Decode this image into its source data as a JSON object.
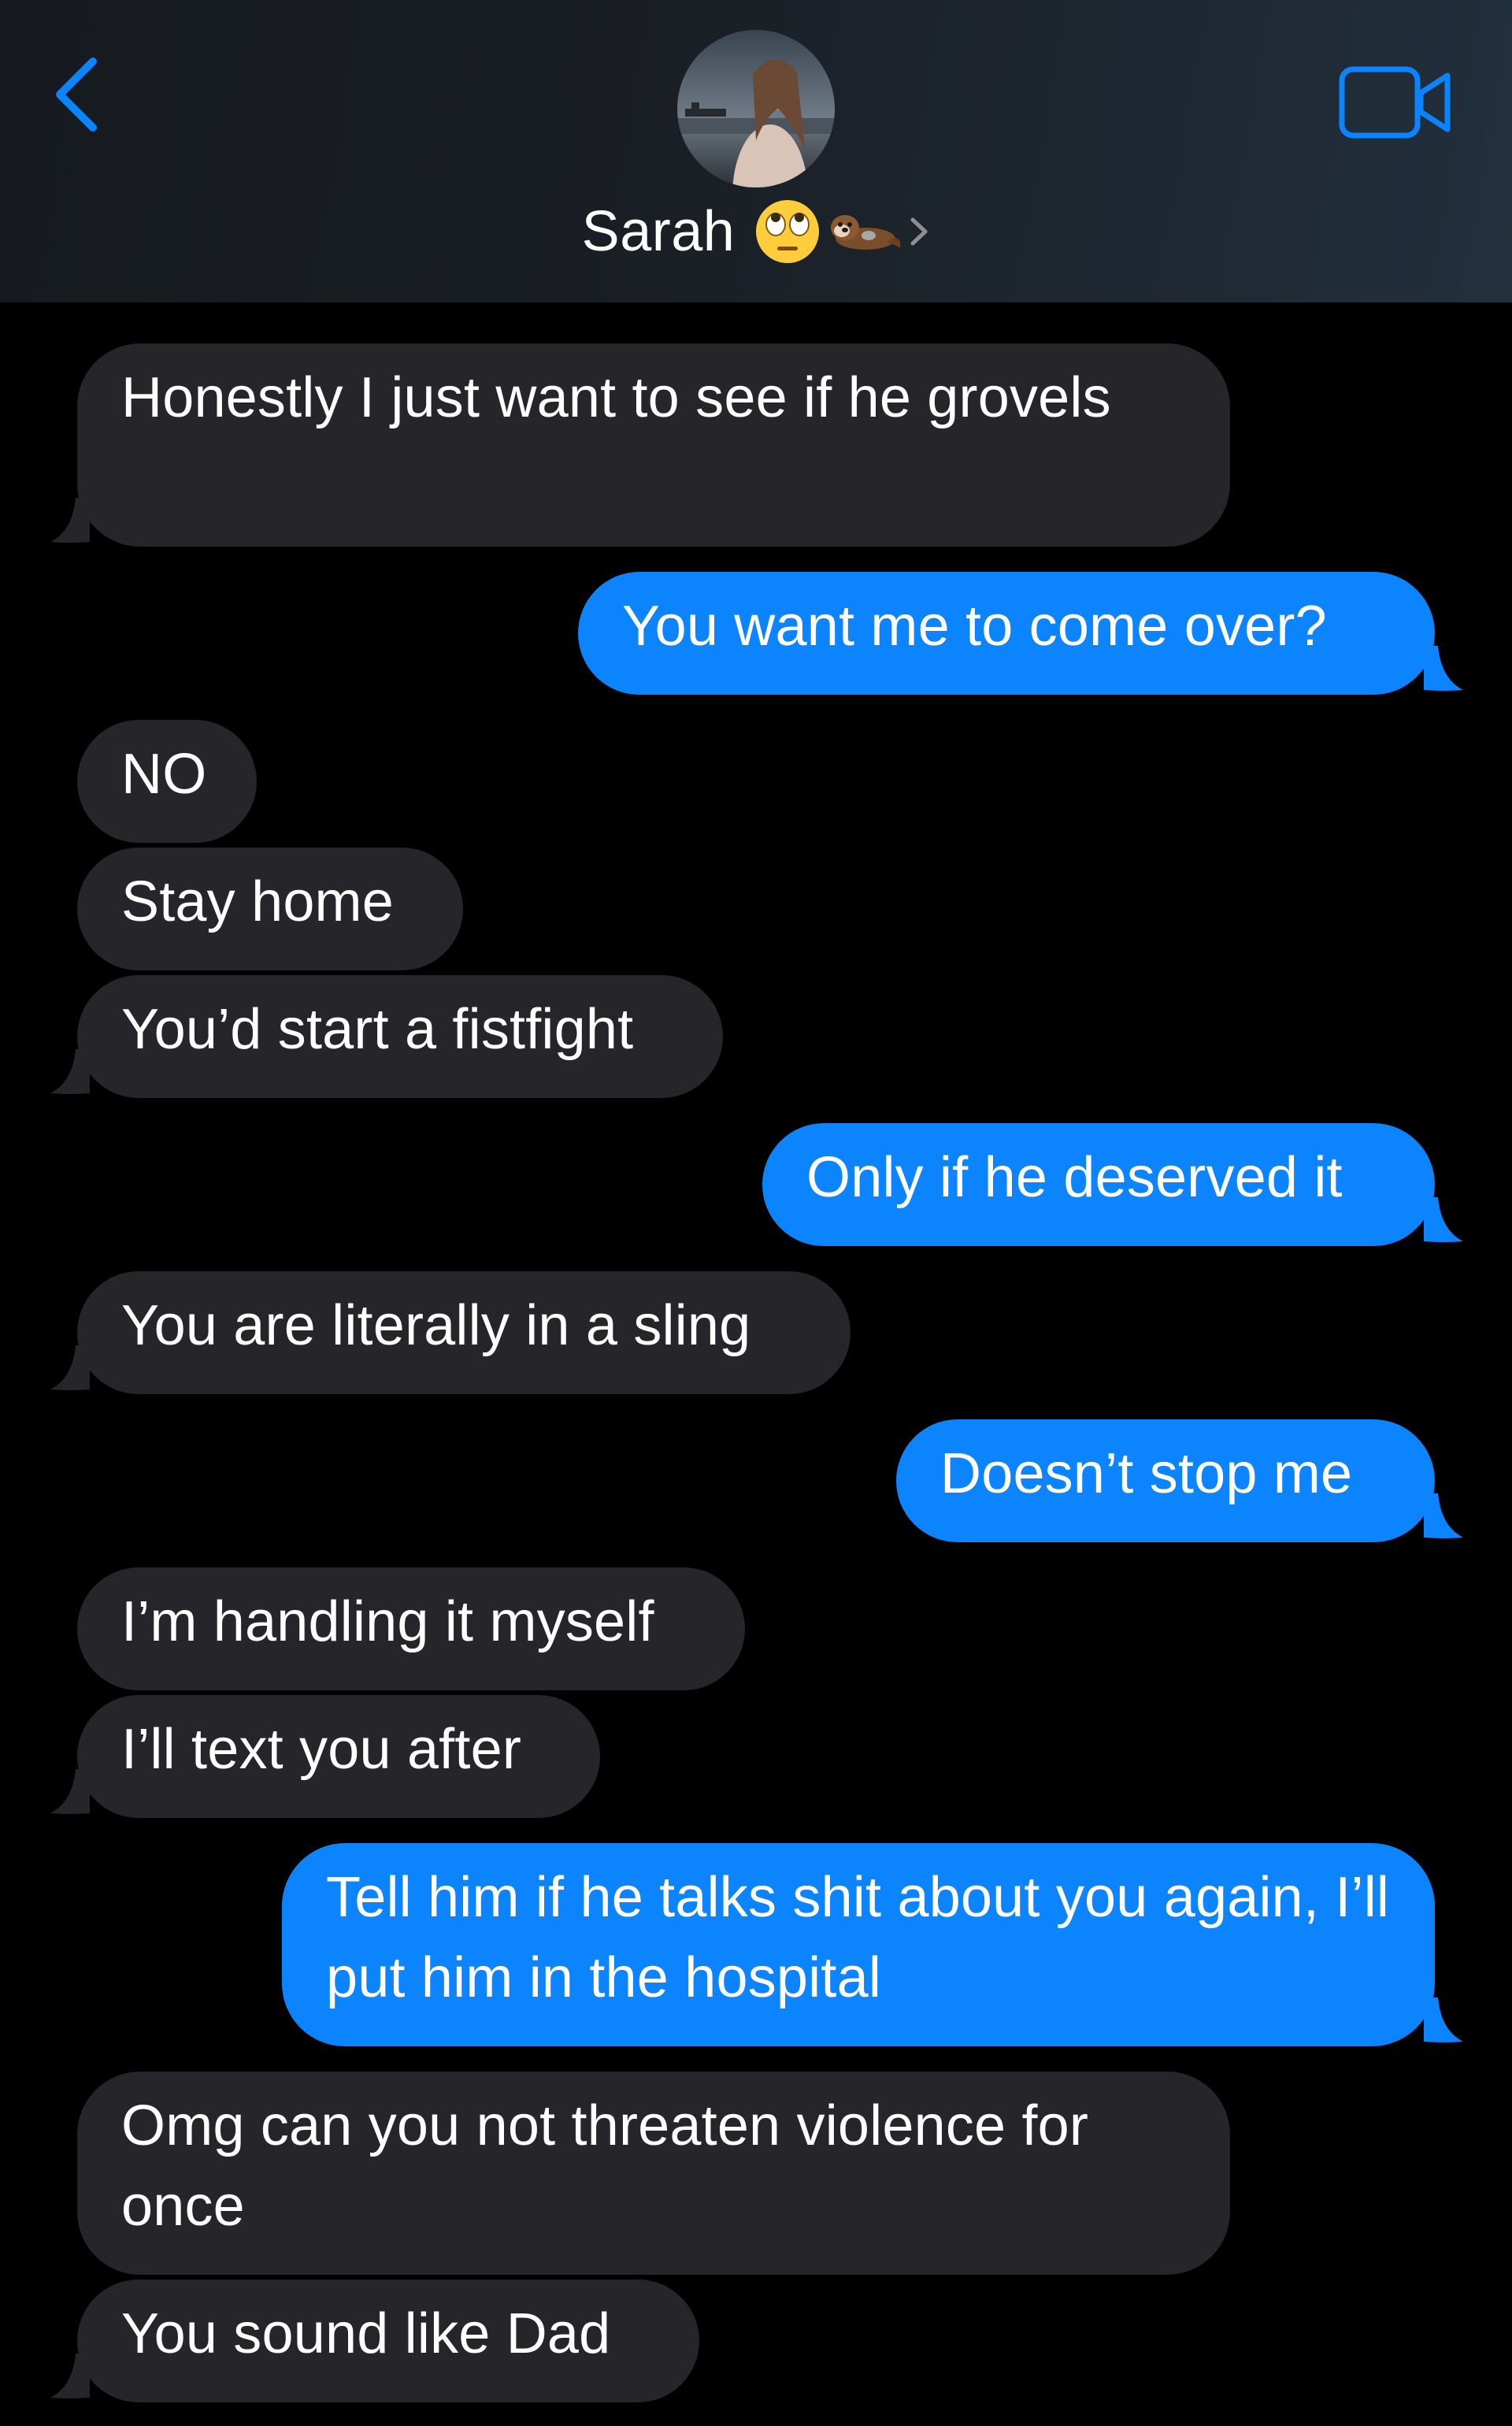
{
  "header": {
    "back_label": "Back",
    "contact_name": "Sarah",
    "contact_emojis": [
      "face-with-rolling-eyes-icon",
      "otter-icon"
    ],
    "video_call_label": "FaceTime video"
  },
  "colors": {
    "incoming_bubble": "#26252a",
    "outgoing_bubble": "#0b84fe",
    "accent": "#0a84ff",
    "background": "#000000"
  },
  "messages": [
    {
      "side": "incoming",
      "text": "Honestly I just want to see if he grovels"
    },
    {
      "side": "outgoing",
      "text": "You want me to come over?"
    },
    {
      "side": "incoming",
      "text": "NO"
    },
    {
      "side": "incoming",
      "text": "Stay home"
    },
    {
      "side": "incoming",
      "text": "You’d start a fistfight"
    },
    {
      "side": "outgoing",
      "text": "Only if he deserved it"
    },
    {
      "side": "incoming",
      "text": "You are literally in a sling"
    },
    {
      "side": "outgoing",
      "text": "Doesn’t stop me"
    },
    {
      "side": "incoming",
      "text": "I’m handling it myself"
    },
    {
      "side": "incoming",
      "text": "I’ll text you after"
    },
    {
      "side": "outgoing",
      "text": "Tell him if he talks shit about you again, I’ll put him in the hospital"
    },
    {
      "side": "incoming",
      "text": "Omg can you not threaten violence for once"
    },
    {
      "side": "incoming",
      "text": "You sound like Dad"
    }
  ]
}
